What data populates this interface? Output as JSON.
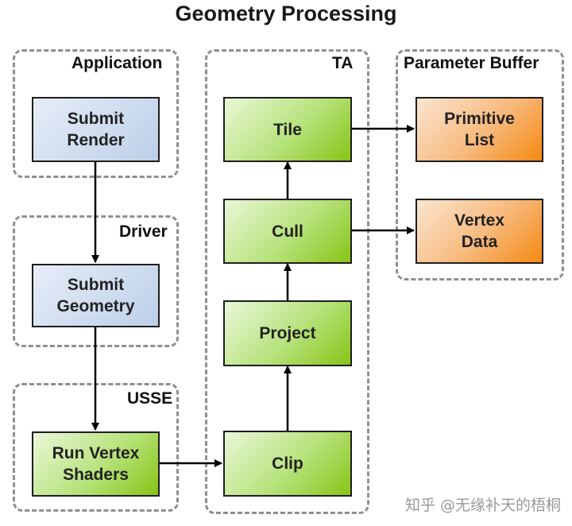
{
  "title": "Geometry Processing",
  "groups": {
    "application": "Application",
    "driver": "Driver",
    "usse": "USSE",
    "ta": "TA",
    "parameter_buffer": "Parameter Buffer"
  },
  "boxes": {
    "submit_render": [
      "Submit",
      "Render"
    ],
    "submit_geometry": [
      "Submit",
      "Geometry"
    ],
    "run_vertex_shaders": [
      "Run Vertex",
      "Shaders"
    ],
    "tile": "Tile",
    "cull": "Cull",
    "project": "Project",
    "clip": "Clip",
    "primitive_list": [
      "Primitive",
      "List"
    ],
    "vertex_data": [
      "Vertex",
      "Data"
    ]
  },
  "colors": {
    "blue_box": "#bccfe8",
    "green_box": "#88c417",
    "orange_box": "#f58a12",
    "group_border": "#8f8f8f"
  },
  "watermark": "知乎 @无缘补天的梧桐"
}
